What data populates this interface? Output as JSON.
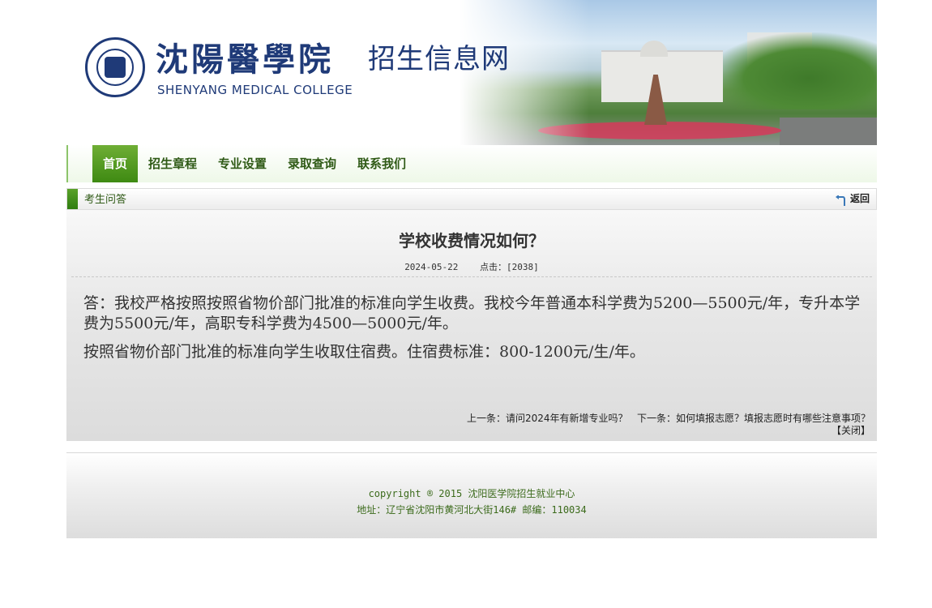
{
  "header": {
    "brand_cn": "沈陽醫學院",
    "brand_en": "SHENYANG MEDICAL COLLEGE",
    "site_title": "招生信息网"
  },
  "nav": {
    "items": [
      {
        "label": "首页",
        "active": true
      },
      {
        "label": "招生章程",
        "active": false
      },
      {
        "label": "专业设置",
        "active": false
      },
      {
        "label": "录取查询",
        "active": false
      },
      {
        "label": "联系我们",
        "active": false
      }
    ]
  },
  "section": {
    "title": "考生问答",
    "back_label": "返回"
  },
  "article": {
    "title": "学校收费情况如何？",
    "date": "2024-05-22",
    "hits": "点击：[2038]",
    "paragraphs": [
      "答：我校严格按照按照省物价部门批准的标准向学生收费。我校今年普通本科学费为5200—5500元/年，专升本学费为5500元/年，高职专科学费为4500—5000元/年。",
      "按照省物价部门批准的标准向学生收取住宿费。住宿费标准：800-1200元/生/年。"
    ],
    "prev_prefix": "上一条：",
    "prev_title": "请问2024年有新增专业吗？",
    "next_prefix": "下一条：",
    "next_title": "如何填报志愿？填报志愿时有哪些注意事项？",
    "close_label": "【关闭】"
  },
  "footer": {
    "copyright": "copyright ® 2015 沈阳医学院招生就业中心",
    "address": "地址：辽宁省沈阳市黄河北大街146# 邮编：110034"
  },
  "colors": {
    "brand_blue": "#1f3a78",
    "nav_green": "#3e8a12",
    "nav_text": "#2f5a16"
  }
}
